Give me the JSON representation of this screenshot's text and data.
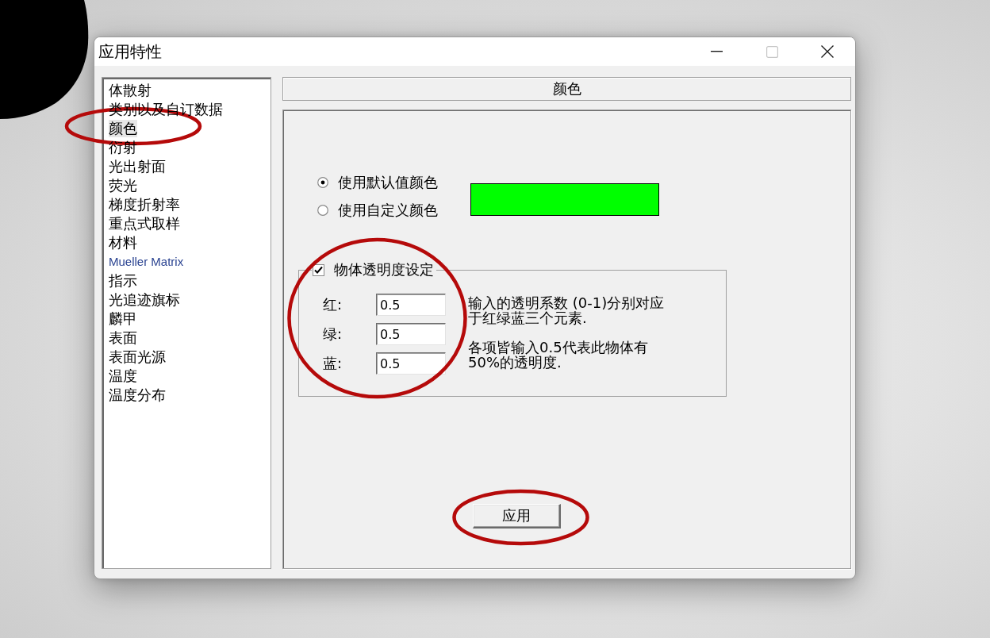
{
  "window": {
    "title": "应用特性",
    "controls": [
      {
        "kind": "minimize",
        "disabled": false
      },
      {
        "kind": "maximize",
        "disabled": true
      },
      {
        "kind": "close",
        "disabled": false
      }
    ]
  },
  "sidebar": {
    "items": [
      {
        "label": "体散射",
        "kind": "standard",
        "selected": false
      },
      {
        "label": "类别以及自订数据",
        "kind": "standard",
        "selected": false
      },
      {
        "label": "颜色",
        "kind": "standard",
        "selected": true
      },
      {
        "label": "衍射",
        "kind": "standard",
        "selected": false
      },
      {
        "label": "光出射面",
        "kind": "standard",
        "selected": false
      },
      {
        "label": "荧光",
        "kind": "standard",
        "selected": false
      },
      {
        "label": "梯度折射率",
        "kind": "standard",
        "selected": false
      },
      {
        "label": "重点式取样",
        "kind": "standard",
        "selected": false
      },
      {
        "label": "材料",
        "kind": "standard",
        "selected": false
      },
      {
        "label": "Mueller Matrix",
        "kind": "accent",
        "selected": false
      },
      {
        "label": "指示",
        "kind": "standard",
        "selected": false
      },
      {
        "label": "光追迹旗标",
        "kind": "standard",
        "selected": false
      },
      {
        "label": "麟甲",
        "kind": "standard",
        "selected": false
      },
      {
        "label": "表面",
        "kind": "standard",
        "selected": false
      },
      {
        "label": "表面光源",
        "kind": "standard",
        "selected": false
      },
      {
        "label": "温度",
        "kind": "standard",
        "selected": false
      },
      {
        "label": "温度分布",
        "kind": "standard",
        "selected": false
      }
    ]
  },
  "panel": {
    "title": "颜色",
    "color_options": [
      {
        "label": "使用默认值颜色",
        "selected": true
      },
      {
        "label": "使用自定义颜色",
        "selected": false
      }
    ],
    "swatch": {
      "color": "#00ff00"
    },
    "transparency": {
      "label": "物体透明度设定",
      "checked": true,
      "fields": [
        {
          "label": "红:",
          "value": "0.5"
        },
        {
          "label": "绿:",
          "value": "0.5"
        },
        {
          "label": "蓝:",
          "value": "0.5"
        }
      ],
      "notes": [
        "输入的透明系数 (0-1)分别对应于红绿蓝三个元素.",
        "各项皆输入0.5代表此物体有50%的透明度."
      ]
    },
    "apply_button": {
      "label": "应用"
    }
  }
}
